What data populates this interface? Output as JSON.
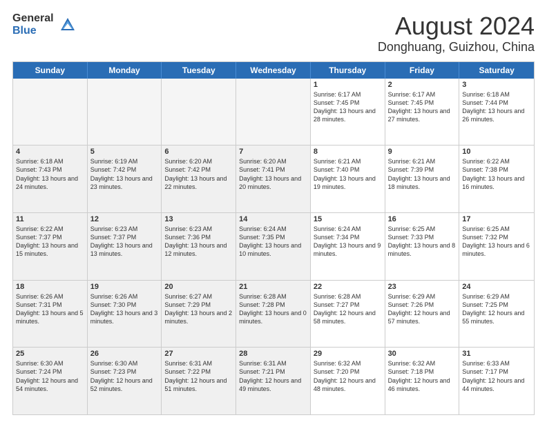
{
  "logo": {
    "general": "General",
    "blue": "Blue"
  },
  "title": "August 2024",
  "subtitle": "Donghuang, Guizhou, China",
  "header_days": [
    "Sunday",
    "Monday",
    "Tuesday",
    "Wednesday",
    "Thursday",
    "Friday",
    "Saturday"
  ],
  "weeks": [
    [
      {
        "day": "",
        "info": "",
        "shaded": true
      },
      {
        "day": "",
        "info": "",
        "shaded": true
      },
      {
        "day": "",
        "info": "",
        "shaded": true
      },
      {
        "day": "",
        "info": "",
        "shaded": true
      },
      {
        "day": "1",
        "info": "Sunrise: 6:17 AM\nSunset: 7:45 PM\nDaylight: 13 hours and 28 minutes.",
        "shaded": false
      },
      {
        "day": "2",
        "info": "Sunrise: 6:17 AM\nSunset: 7:45 PM\nDaylight: 13 hours and 27 minutes.",
        "shaded": false
      },
      {
        "day": "3",
        "info": "Sunrise: 6:18 AM\nSunset: 7:44 PM\nDaylight: 13 hours and 26 minutes.",
        "shaded": false
      }
    ],
    [
      {
        "day": "4",
        "info": "Sunrise: 6:18 AM\nSunset: 7:43 PM\nDaylight: 13 hours and 24 minutes.",
        "shaded": true
      },
      {
        "day": "5",
        "info": "Sunrise: 6:19 AM\nSunset: 7:42 PM\nDaylight: 13 hours and 23 minutes.",
        "shaded": true
      },
      {
        "day": "6",
        "info": "Sunrise: 6:20 AM\nSunset: 7:42 PM\nDaylight: 13 hours and 22 minutes.",
        "shaded": true
      },
      {
        "day": "7",
        "info": "Sunrise: 6:20 AM\nSunset: 7:41 PM\nDaylight: 13 hours and 20 minutes.",
        "shaded": true
      },
      {
        "day": "8",
        "info": "Sunrise: 6:21 AM\nSunset: 7:40 PM\nDaylight: 13 hours and 19 minutes.",
        "shaded": false
      },
      {
        "day": "9",
        "info": "Sunrise: 6:21 AM\nSunset: 7:39 PM\nDaylight: 13 hours and 18 minutes.",
        "shaded": false
      },
      {
        "day": "10",
        "info": "Sunrise: 6:22 AM\nSunset: 7:38 PM\nDaylight: 13 hours and 16 minutes.",
        "shaded": false
      }
    ],
    [
      {
        "day": "11",
        "info": "Sunrise: 6:22 AM\nSunset: 7:37 PM\nDaylight: 13 hours and 15 minutes.",
        "shaded": true
      },
      {
        "day": "12",
        "info": "Sunrise: 6:23 AM\nSunset: 7:37 PM\nDaylight: 13 hours and 13 minutes.",
        "shaded": true
      },
      {
        "day": "13",
        "info": "Sunrise: 6:23 AM\nSunset: 7:36 PM\nDaylight: 13 hours and 12 minutes.",
        "shaded": true
      },
      {
        "day": "14",
        "info": "Sunrise: 6:24 AM\nSunset: 7:35 PM\nDaylight: 13 hours and 10 minutes.",
        "shaded": true
      },
      {
        "day": "15",
        "info": "Sunrise: 6:24 AM\nSunset: 7:34 PM\nDaylight: 13 hours and 9 minutes.",
        "shaded": false
      },
      {
        "day": "16",
        "info": "Sunrise: 6:25 AM\nSunset: 7:33 PM\nDaylight: 13 hours and 8 minutes.",
        "shaded": false
      },
      {
        "day": "17",
        "info": "Sunrise: 6:25 AM\nSunset: 7:32 PM\nDaylight: 13 hours and 6 minutes.",
        "shaded": false
      }
    ],
    [
      {
        "day": "18",
        "info": "Sunrise: 6:26 AM\nSunset: 7:31 PM\nDaylight: 13 hours and 5 minutes.",
        "shaded": true
      },
      {
        "day": "19",
        "info": "Sunrise: 6:26 AM\nSunset: 7:30 PM\nDaylight: 13 hours and 3 minutes.",
        "shaded": true
      },
      {
        "day": "20",
        "info": "Sunrise: 6:27 AM\nSunset: 7:29 PM\nDaylight: 13 hours and 2 minutes.",
        "shaded": true
      },
      {
        "day": "21",
        "info": "Sunrise: 6:28 AM\nSunset: 7:28 PM\nDaylight: 13 hours and 0 minutes.",
        "shaded": true
      },
      {
        "day": "22",
        "info": "Sunrise: 6:28 AM\nSunset: 7:27 PM\nDaylight: 12 hours and 58 minutes.",
        "shaded": false
      },
      {
        "day": "23",
        "info": "Sunrise: 6:29 AM\nSunset: 7:26 PM\nDaylight: 12 hours and 57 minutes.",
        "shaded": false
      },
      {
        "day": "24",
        "info": "Sunrise: 6:29 AM\nSunset: 7:25 PM\nDaylight: 12 hours and 55 minutes.",
        "shaded": false
      }
    ],
    [
      {
        "day": "25",
        "info": "Sunrise: 6:30 AM\nSunset: 7:24 PM\nDaylight: 12 hours and 54 minutes.",
        "shaded": true
      },
      {
        "day": "26",
        "info": "Sunrise: 6:30 AM\nSunset: 7:23 PM\nDaylight: 12 hours and 52 minutes.",
        "shaded": true
      },
      {
        "day": "27",
        "info": "Sunrise: 6:31 AM\nSunset: 7:22 PM\nDaylight: 12 hours and 51 minutes.",
        "shaded": true
      },
      {
        "day": "28",
        "info": "Sunrise: 6:31 AM\nSunset: 7:21 PM\nDaylight: 12 hours and 49 minutes.",
        "shaded": true
      },
      {
        "day": "29",
        "info": "Sunrise: 6:32 AM\nSunset: 7:20 PM\nDaylight: 12 hours and 48 minutes.",
        "shaded": false
      },
      {
        "day": "30",
        "info": "Sunrise: 6:32 AM\nSunset: 7:18 PM\nDaylight: 12 hours and 46 minutes.",
        "shaded": false
      },
      {
        "day": "31",
        "info": "Sunrise: 6:33 AM\nSunset: 7:17 PM\nDaylight: 12 hours and 44 minutes.",
        "shaded": false
      }
    ]
  ]
}
